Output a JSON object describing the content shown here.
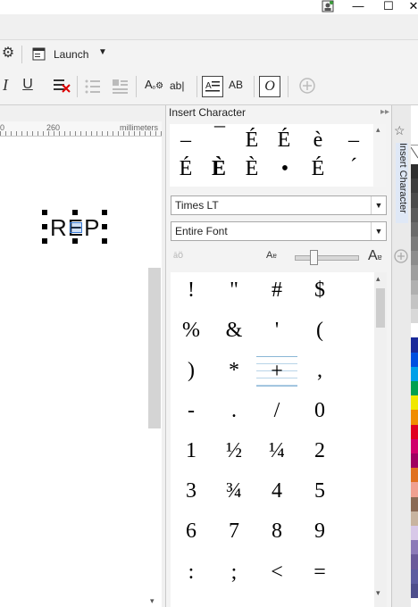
{
  "titlebar": {
    "minimize": "—",
    "maximize": "☐",
    "close": "✕"
  },
  "toolbar": {
    "launch_label": "Launch",
    "italic": "I",
    "underline": "U",
    "size_icon_text": "A",
    "ab_text": "ab|",
    "ab2_text": "AB",
    "o_text": "O"
  },
  "ruler": {
    "tick1": "0",
    "tick2": "260",
    "units": "millimeters"
  },
  "canvas": {
    "selected_text": "REP"
  },
  "docker": {
    "title": "Insert Character",
    "tab_label": "Insert Character",
    "recent_chars": [
      "–",
      "¯",
      "É",
      "É",
      "è",
      "–",
      "É",
      "È",
      "È",
      "•",
      "É",
      "´"
    ],
    "font_value": "Times LT",
    "subset_value": "Entire Font",
    "grid_chars": [
      "!",
      "\"",
      "#",
      "$",
      "%",
      "&",
      "'",
      "(",
      ")",
      "*",
      "+",
      ",",
      "-",
      ".",
      "/",
      "0",
      "1",
      "½",
      "¼",
      "2",
      "3",
      "¾",
      "4",
      "5",
      "6",
      "7",
      "8",
      "9",
      ":",
      ";",
      "<",
      "="
    ],
    "selected_char": "+"
  },
  "palette": {
    "colors": [
      "#2f2f2f",
      "#3d3d3d",
      "#4b4b4b",
      "#5a5a5a",
      "#6a6a6a",
      "#7b7b7b",
      "#8c8c8c",
      "#9e9e9e",
      "#b0b0b0",
      "#c4c4c4",
      "#d8d8d8",
      "#ffffff",
      "#1a2a9a",
      "#0050e0",
      "#00a0e8",
      "#00a050",
      "#f0e800",
      "#f08c00",
      "#e00020",
      "#d0006a",
      "#a00060",
      "#e07020",
      "#f0a090",
      "#8b6a55",
      "#c8b4a0",
      "#d8c8e8",
      "#8c7ab8",
      "#6a5a9a",
      "#5c5ca0",
      "#4e4e8c"
    ]
  }
}
